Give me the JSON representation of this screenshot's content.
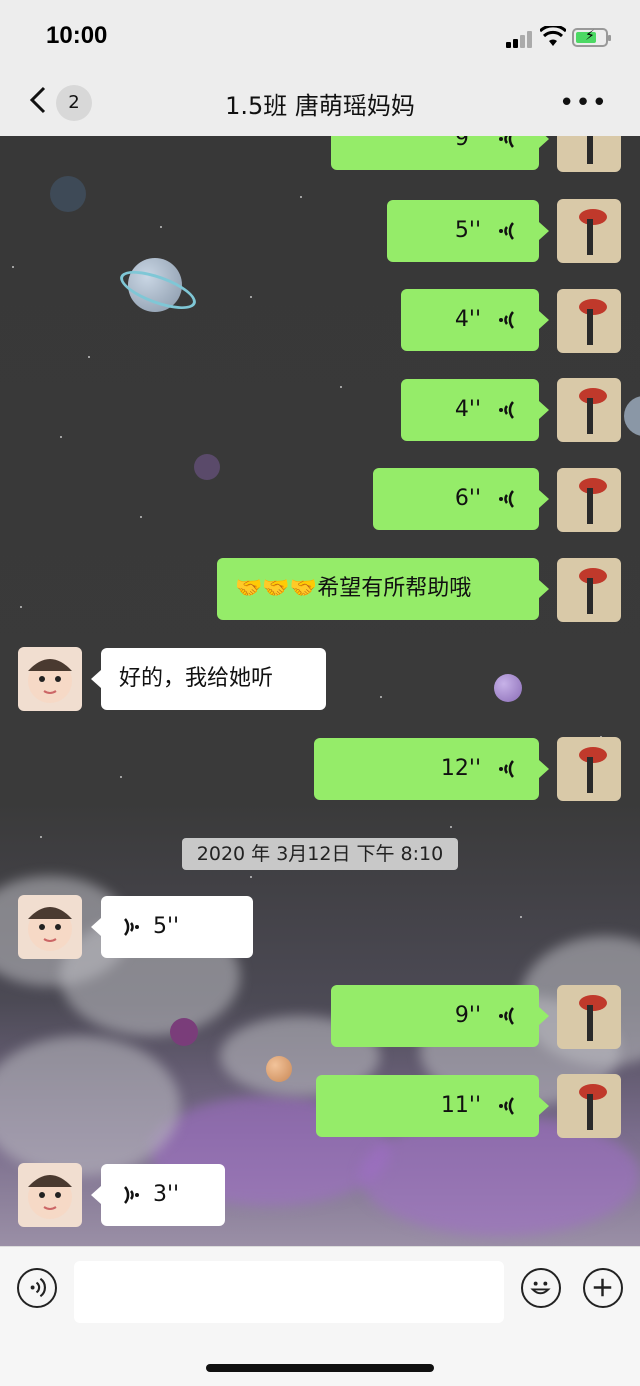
{
  "status": {
    "time": "10:00"
  },
  "header": {
    "back_icon": "chevron-left-icon",
    "unread": "2",
    "title": "1.5班 唐萌瑶妈妈",
    "more_icon": "ellipsis-icon"
  },
  "messages": {
    "m1": {
      "duration": "9''"
    },
    "m2": {
      "duration": "5''"
    },
    "m3": {
      "duration": "4''"
    },
    "m4": {
      "duration": "4''"
    },
    "m5": {
      "duration": "6''"
    },
    "m6": {
      "emoji": "🤝🤝🤝",
      "text": "希望有所帮助哦"
    },
    "m7": {
      "text": "好的，我给她听"
    },
    "m8": {
      "duration": "12''"
    },
    "timestamp": "2020 年 3月12日 下午 8:10",
    "m9": {
      "duration": "5''"
    },
    "m10": {
      "duration": "9''"
    },
    "m11": {
      "duration": "11''"
    },
    "m12": {
      "duration": "3''"
    }
  },
  "input_bar": {
    "voice_icon": "voice-icon",
    "emoji_icon": "emoji-icon",
    "plus_icon": "plus-icon"
  },
  "colors": {
    "bubble_sent": "#95ec69",
    "bubble_received": "#ffffff",
    "bar": "#ededed"
  }
}
